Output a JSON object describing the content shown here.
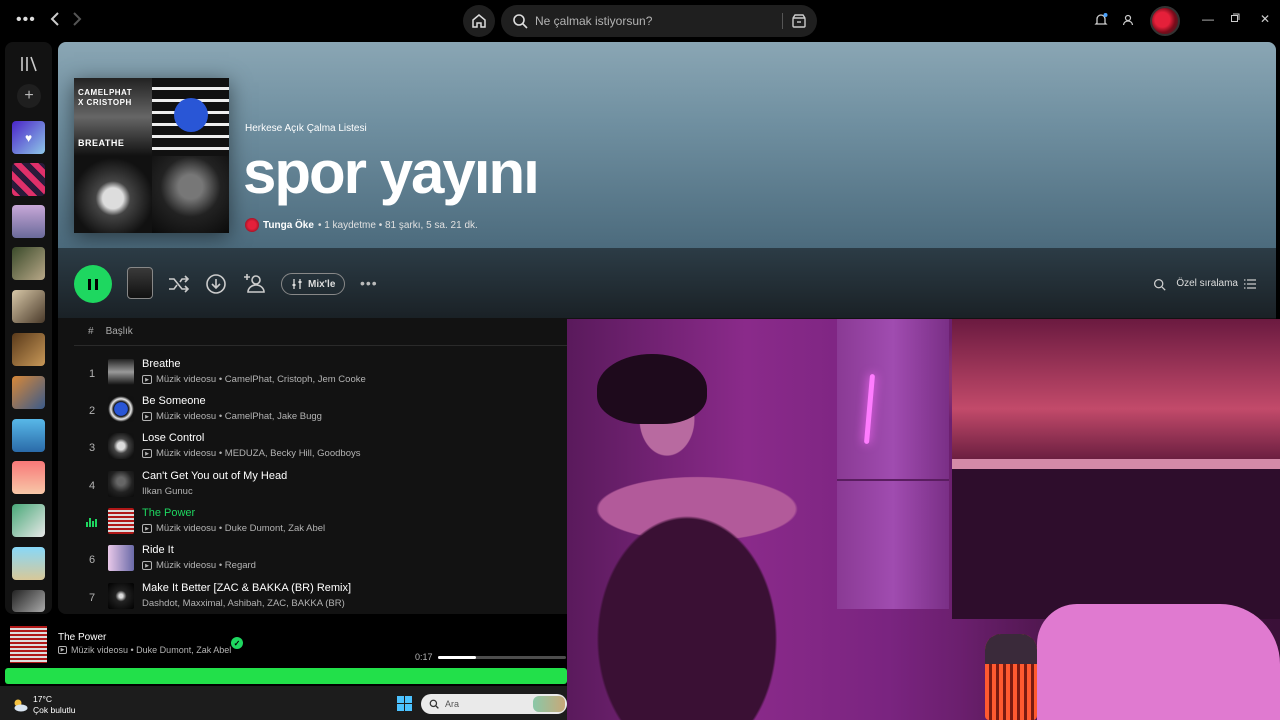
{
  "topbar": {
    "search_placeholder": "Ne çalmak istiyorsun?"
  },
  "playlist": {
    "type_label": "Herkese Açık Çalma Listesi",
    "title": "spor yayını",
    "owner": "Tunga Öke",
    "meta": "• 1 kaydetme • 81 şarkı, 5 sa. 21 dk.",
    "cover_text": {
      "artist_line1": "CAMELPHAT",
      "artist_line2": "X CRISTOPH",
      "song": "BREATHE"
    }
  },
  "actions": {
    "mix_label": "Mix'le",
    "sort_label": "Özel sıralama"
  },
  "table": {
    "col_number": "#",
    "col_title": "Başlık"
  },
  "tracks": [
    {
      "num": "1",
      "title": "Breathe",
      "artists": "Müzik videosu • CamelPhat, Cristoph, Jem Cooke",
      "video": true
    },
    {
      "num": "2",
      "title": "Be Someone",
      "artists": "Müzik videosu • CamelPhat, Jake Bugg",
      "video": true
    },
    {
      "num": "3",
      "title": "Lose Control",
      "artists": "Müzik videosu • MEDUZA, Becky Hill, Goodboys",
      "video": true
    },
    {
      "num": "4",
      "title": "Can't Get You out of My Head",
      "artists": "Ilkan Gunuc",
      "video": false
    },
    {
      "num": "",
      "title": "The Power",
      "artists": "Müzik videosu • Duke Dumont, Zak Abel",
      "video": true,
      "playing": true
    },
    {
      "num": "6",
      "title": "Ride It",
      "artists": "Müzik videosu • Regard",
      "video": true
    },
    {
      "num": "7",
      "title": "Make It Better [ZAC & BAKKA (BR) Remix]",
      "artists": "Dashdot, Maxximal, Ashibah, ZAC, BAKKA (BR)",
      "video": false
    }
  ],
  "now_playing": {
    "title": "The Power",
    "artists": "Müzik videosu • Duke Dumont, Zak Abel",
    "elapsed": "0:17",
    "progress_fraction": 0.3
  },
  "taskbar": {
    "temperature": "17°C",
    "condition": "Çok bulutlu",
    "search_text": "Ara"
  },
  "colors": {
    "accent_green": "#1ed760",
    "header_gradient_top": "#8aa6b4"
  }
}
